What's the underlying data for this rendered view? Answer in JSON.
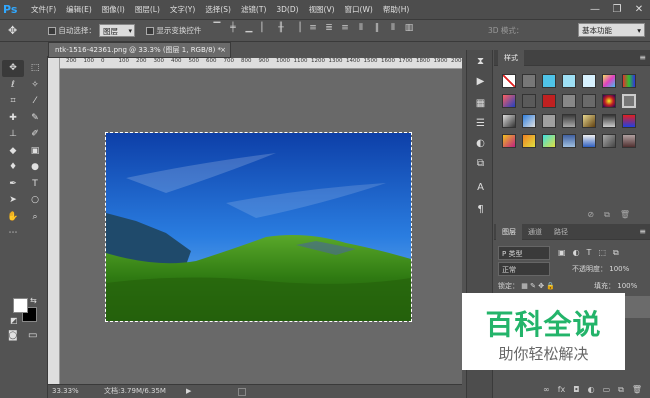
{
  "app": {
    "logo": "Ps"
  },
  "menubar": {
    "items": [
      "文件(F)",
      "编辑(E)",
      "图像(I)",
      "图层(L)",
      "文字(Y)",
      "选择(S)",
      "滤镜(T)",
      "3D(D)",
      "视图(V)",
      "窗口(W)",
      "帮助(H)"
    ],
    "minimize": "—",
    "restore": "❐",
    "close": "✕"
  },
  "options": {
    "move_icon": "✥",
    "auto_select_label": "自动选择：",
    "auto_select_value": "图层",
    "show_transform_label": "显示变换控件",
    "mode_3d_label": "3D 模式：",
    "workspace": "基本功能"
  },
  "document": {
    "tab_title": "ntk-1516-42361.png @ 33.3% (图层 1, RGB/8) *",
    "close": "×",
    "zoom": "33.33%",
    "info": "文档:3.79M/6.35M",
    "status_arrow": "▶"
  },
  "ruler": {
    "ticks": [
      "200",
      "100",
      "0",
      "100",
      "200",
      "300",
      "400",
      "500",
      "600",
      "700",
      "800",
      "900",
      "1000",
      "1100",
      "1200",
      "1300",
      "1400",
      "1500",
      "1600",
      "1700",
      "1800",
      "1900",
      "2000"
    ]
  },
  "styles_panel": {
    "tab": "样式",
    "menu": "≡"
  },
  "layers_panel": {
    "tabs": [
      "图层",
      "通道",
      "路径"
    ],
    "menu": "≡",
    "kind_label": "P 类型",
    "blend_mode": "正常",
    "opacity_label": "不透明度：",
    "opacity_value": "100%",
    "lock_label": "锁定：",
    "fill_label": "填充：",
    "fill_value": "100%"
  },
  "watermark": {
    "title": "百科全说",
    "subtitle": "助你轻松解决"
  },
  "colors": {
    "accent": "#31a8ff",
    "brand_green": "#23b46a",
    "ui_dark": "#535353"
  },
  "icons": {
    "tools": [
      "move-icon",
      "marquee-icon",
      "lasso-icon",
      "magic-wand-icon",
      "crop-icon",
      "eyedropper-icon",
      "healing-brush-icon",
      "brush-icon",
      "clone-stamp-icon",
      "history-brush-icon",
      "eraser-icon",
      "gradient-icon",
      "blur-icon",
      "dodge-icon",
      "pen-icon",
      "type-icon",
      "path-select-icon",
      "shape-icon",
      "hand-icon",
      "zoom-icon",
      "more-tools-icon"
    ]
  }
}
